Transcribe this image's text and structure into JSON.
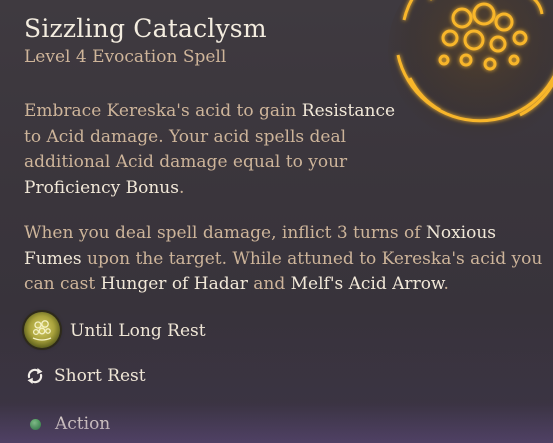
{
  "spell": {
    "title": "Sizzling Cataclysm",
    "subtitle": "Level 4 Evocation Spell"
  },
  "description": {
    "p1": [
      {
        "t": "Embrace Kereska's acid to gain ",
        "hl": false
      },
      {
        "t": "Resistance",
        "hl": true
      },
      {
        "t": " to Acid damage. Your acid spells deal additional Acid damage equal to your ",
        "hl": false
      },
      {
        "t": "Proficiency Bonus",
        "hl": true
      },
      {
        "t": ".",
        "hl": false
      }
    ],
    "p2": [
      {
        "t": "When you deal spell damage, inflict 3 turns of ",
        "hl": false
      },
      {
        "t": "Noxious Fumes",
        "hl": true
      },
      {
        "t": " upon the target. While attuned to Kereska's acid you can cast ",
        "hl": false
      },
      {
        "t": "Hunger of Hadar",
        "hl": true
      },
      {
        "t": " and ",
        "hl": false
      },
      {
        "t": "Melf's Acid Arrow",
        "hl": true
      },
      {
        "t": ".",
        "hl": false
      }
    ]
  },
  "rows": {
    "duration": "Until Long Rest",
    "recharge": "Short Rest",
    "cost": "Action"
  },
  "icons": {
    "emblem": "glowing-rune-emblem-icon",
    "duration": "acid-bubbles-medallion-icon",
    "recharge": "refresh-icon",
    "cost": "action-dot-icon"
  },
  "colors": {
    "title": "#f3ecdf",
    "body": "#cdb49a",
    "highlight": "#f1e8d8",
    "emblem_glow": "#f5a623",
    "action_dot": "#33a140"
  }
}
